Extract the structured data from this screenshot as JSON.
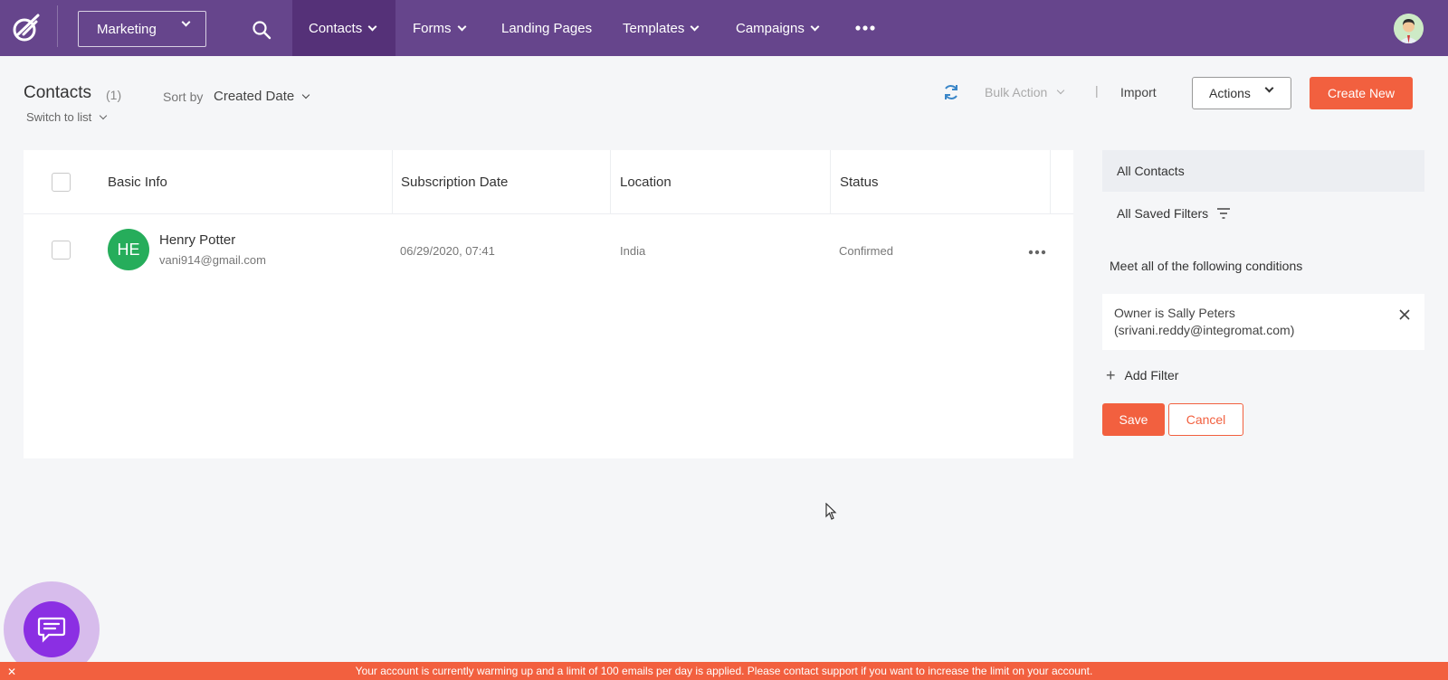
{
  "nav": {
    "workspace": "Marketing",
    "items": [
      {
        "label": "Contacts"
      },
      {
        "label": "Forms"
      },
      {
        "label": "Landing Pages"
      },
      {
        "label": "Templates"
      },
      {
        "label": "Campaigns"
      }
    ]
  },
  "header": {
    "title": "Contacts",
    "count": "(1)",
    "switch_list": "Switch to list",
    "sort_label": "Sort by",
    "sort_value": "Created Date",
    "bulk_action": "Bulk Action",
    "separator": "|",
    "import": "Import",
    "actions": "Actions",
    "create_new": "Create New"
  },
  "table": {
    "columns": [
      "Basic Info",
      "Subscription Date",
      "Location",
      "Status"
    ],
    "rows": [
      {
        "initials": "HE",
        "name": "Henry Potter",
        "email": "vani914@gmail.com",
        "subscription_date": "06/29/2020, 07:41",
        "location": "India",
        "status": "Confirmed"
      }
    ]
  },
  "filters": {
    "all_contacts": "All Contacts",
    "saved_filters": "All Saved Filters",
    "conditions_label": "Meet all of the following conditions",
    "condition_line1": "Owner is Sally Peters",
    "condition_line2": "(srivani.reddy@integromat.com)",
    "add_filter": "Add Filter",
    "save": "Save",
    "cancel": "Cancel"
  },
  "banner": {
    "text": "Your account is currently warming up and a limit of 100 emails per day is applied. Please contact support if you want to increase the limit on your account.",
    "close": "✕"
  },
  "colors": {
    "nav_bg": "#66458c",
    "nav_active": "#553178",
    "accent": "#f2603f",
    "avatar_green": "#26ad5b",
    "chat_purple": "#8b2fe3"
  }
}
